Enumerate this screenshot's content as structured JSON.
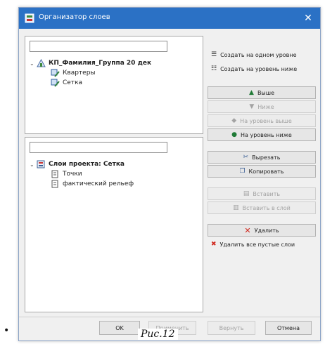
{
  "window": {
    "title": "Организатор слоев",
    "close_symbol": "✕"
  },
  "top_panel": {
    "filter_value": "",
    "root_label": "КП_Фамилия_Группа 20 дек",
    "children": [
      "Квартеры",
      "Сетка"
    ]
  },
  "bottom_panel": {
    "filter_value": "",
    "root_label": "Слои проекта: Сетка",
    "children": [
      "Точки",
      "фактический рельеф"
    ]
  },
  "buttons": {
    "create_same_level": "Создать на одном уровне",
    "create_level_below": "Создать на уровень ниже",
    "up": "Выше",
    "down": "Ниже",
    "level_up": "На уровень выше",
    "level_down": "На уровень ниже",
    "cut": "Вырезать",
    "copy": "Копировать",
    "paste": "Вставить",
    "move_to_layer": "Вставить в слой",
    "delete": "Удалить",
    "delete_empty": "Удалить все пустые слои"
  },
  "footer": {
    "ok": "OK",
    "apply": "Применить",
    "reset": "Вернуть",
    "cancel": "Отмена"
  },
  "caption": "Рис.12",
  "bullet": "•",
  "colors": {
    "title_bar": "#2b71c5",
    "delete_icon": "#d0281e",
    "arrow_icon": "#1f7a36"
  }
}
